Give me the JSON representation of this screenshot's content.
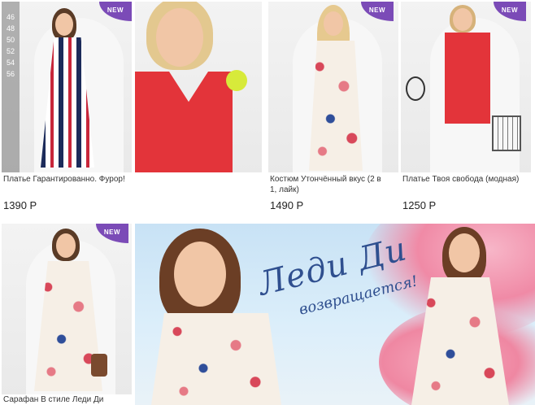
{
  "products": [
    {
      "title": "Платье Гарантированно. Фурор!",
      "price": "1390 Р",
      "badge": "NEW",
      "sizes": [
        "46",
        "48",
        "50",
        "52",
        "54",
        "56"
      ]
    },
    {
      "title": "",
      "price": "",
      "badge": ""
    },
    {
      "title": "Костюм Утончённый вкус (2 в 1, лайк)",
      "price": "1490 Р",
      "badge": "NEW"
    },
    {
      "title": "Платье Твоя свобода (модная)",
      "price": "1250 Р",
      "badge": "NEW"
    },
    {
      "title": "Сарафан В стиле Леди Ди",
      "price": "",
      "badge": "NEW"
    }
  ],
  "banner": {
    "title": "Леди Ди",
    "subtitle": "возвращается!"
  },
  "colors": {
    "badge": "#7b4bb7",
    "banner_text": "#2f4f8f",
    "red_dress": "#e3343a"
  }
}
